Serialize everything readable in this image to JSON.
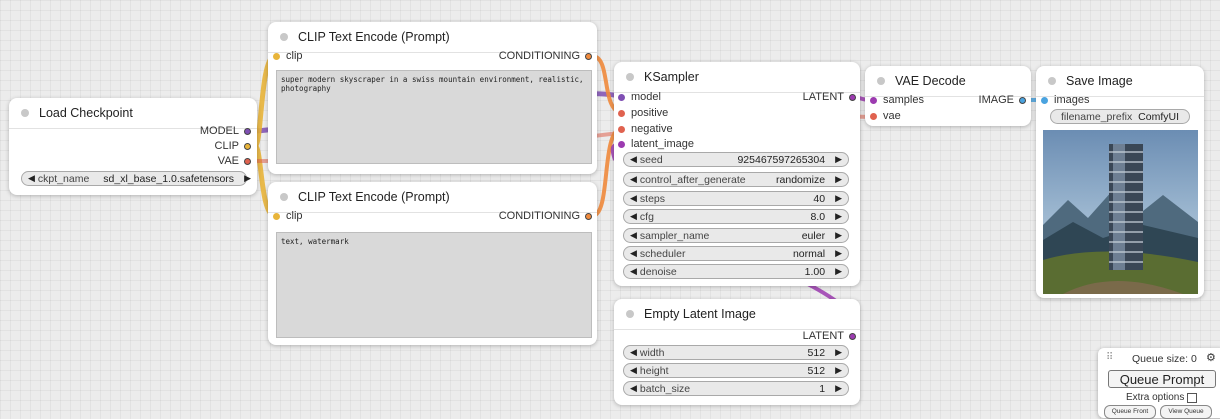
{
  "load_checkpoint": {
    "title": "Load Checkpoint",
    "outputs": [
      "MODEL",
      "CLIP",
      "VAE"
    ],
    "widget": {
      "label": "ckpt_name",
      "value": "sd_xl_base_1.0.safetensors"
    }
  },
  "clip_positive": {
    "title": "CLIP Text Encode (Prompt)",
    "input": "clip",
    "output": "CONDITIONING",
    "text": "super modern skyscraper in a swiss mountain environment, realistic,\nphotography"
  },
  "clip_negative": {
    "title": "CLIP Text Encode (Prompt)",
    "input": "clip",
    "output": "CONDITIONING",
    "text": "text, watermark"
  },
  "ksampler": {
    "title": "KSampler",
    "inputs": [
      "model",
      "positive",
      "negative",
      "latent_image"
    ],
    "output": "LATENT",
    "widgets": [
      {
        "label": "seed",
        "value": "925467597265304"
      },
      {
        "label": "control_after_generate",
        "value": "randomize"
      },
      {
        "label": "steps",
        "value": "40"
      },
      {
        "label": "cfg",
        "value": "8.0"
      },
      {
        "label": "sampler_name",
        "value": "euler"
      },
      {
        "label": "scheduler",
        "value": "normal"
      },
      {
        "label": "denoise",
        "value": "1.00"
      }
    ]
  },
  "empty_latent": {
    "title": "Empty Latent Image",
    "output": "LATENT",
    "widgets": [
      {
        "label": "width",
        "value": "512"
      },
      {
        "label": "height",
        "value": "512"
      },
      {
        "label": "batch_size",
        "value": "1"
      }
    ]
  },
  "vae_decode": {
    "title": "VAE Decode",
    "inputs": [
      "samples",
      "vae"
    ],
    "output": "IMAGE"
  },
  "save_image": {
    "title": "Save Image",
    "input": "images",
    "widget": {
      "label": "filename_prefix",
      "value": "ComfyUI"
    }
  },
  "queue_panel": {
    "queue_size": "Queue size: 0",
    "queue_button": "Queue Prompt",
    "extra_options": "Extra options",
    "queue_front": "Queue Front",
    "view_queue": "View Queue"
  },
  "colors": {
    "model": "#7f4fb3",
    "clip": "#e8b43a",
    "vae": "#e0624f",
    "conditioning": "#f08a3c",
    "latent": "#9c3bb0",
    "image": "#4aa3df"
  }
}
